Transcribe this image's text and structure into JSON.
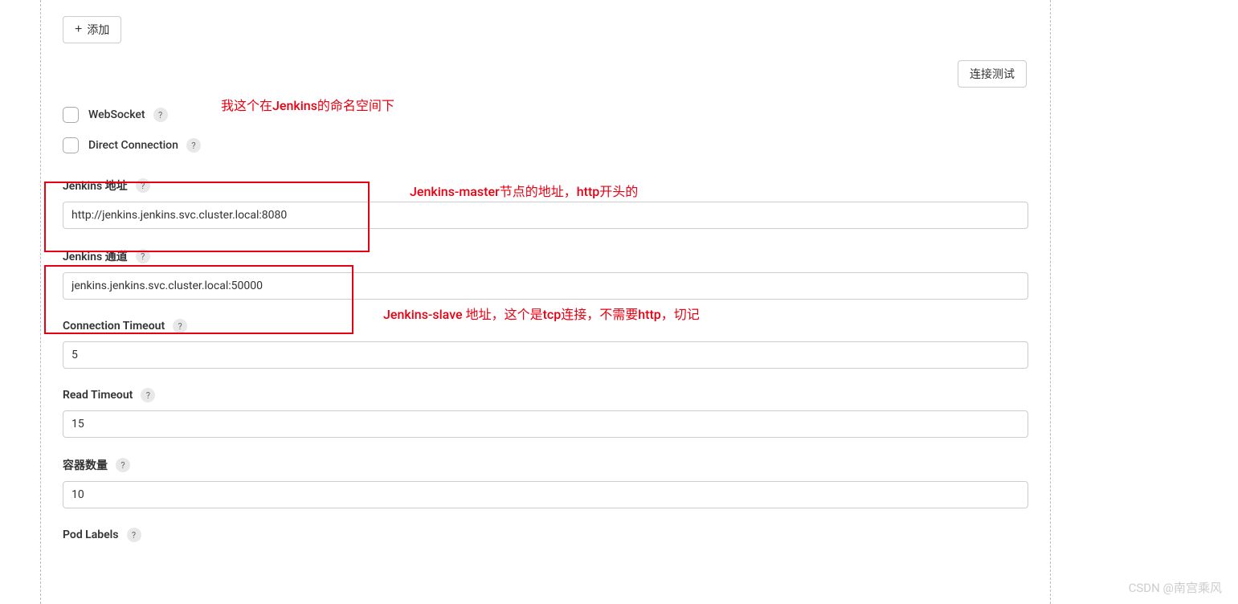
{
  "buttons": {
    "add": "添加",
    "test_connection": "连接测试"
  },
  "checkboxes": {
    "websocket": "WebSocket",
    "direct_connection": "Direct Connection"
  },
  "fields": {
    "jenkins_url": {
      "label": "Jenkins 地址",
      "value": "http://jenkins.jenkins.svc.cluster.local:8080"
    },
    "jenkins_tunnel": {
      "label": "Jenkins 通道",
      "value": "jenkins.jenkins.svc.cluster.local:50000"
    },
    "connection_timeout": {
      "label": "Connection Timeout",
      "value": "5"
    },
    "read_timeout": {
      "label": "Read Timeout",
      "value": "15"
    },
    "container_cap": {
      "label": "容器数量",
      "value": "10"
    },
    "pod_labels": {
      "label": "Pod Labels"
    }
  },
  "annotations": {
    "namespace_note": "我这个在Jenkins的命名空间下",
    "master_note": "Jenkins-master节点的地址，http开头的",
    "slave_note": "Jenkins-slave 地址，这个是tcp连接，不需要http，切记"
  },
  "help": "?",
  "watermark": "CSDN @南宫乘风"
}
